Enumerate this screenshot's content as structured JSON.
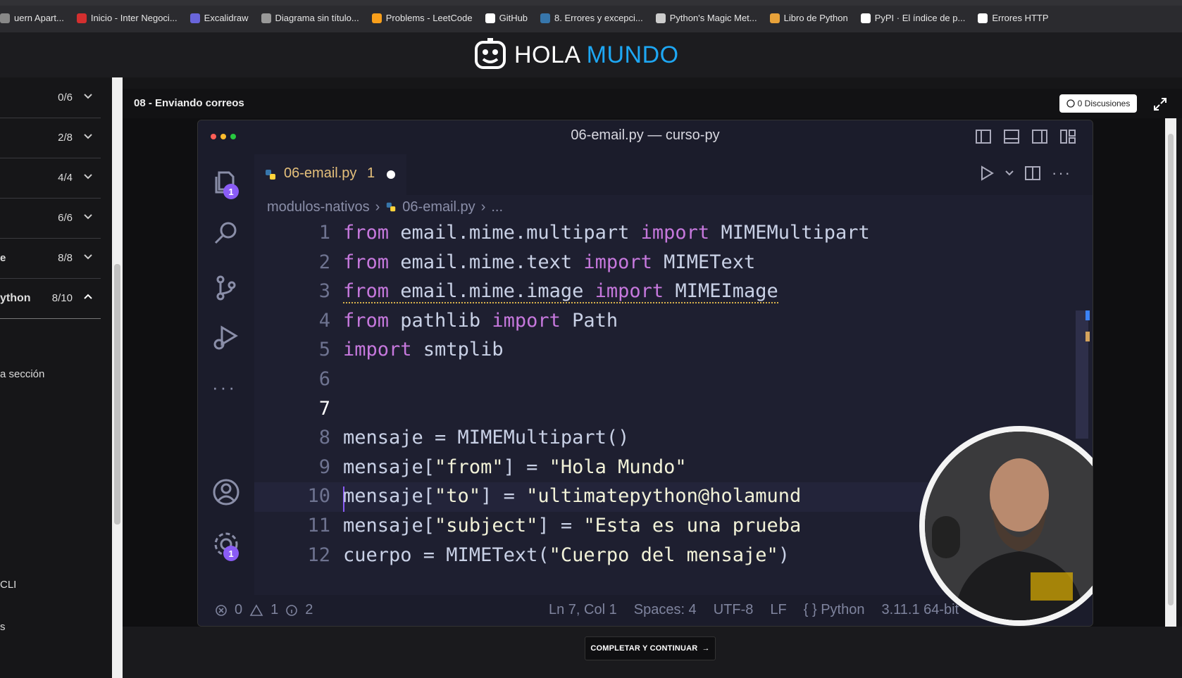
{
  "bookmarks": [
    {
      "label": "uern Apart...",
      "icon": "page-icon",
      "color": "#888888"
    },
    {
      "label": "Inicio - Inter Negoci...",
      "icon": "bank-icon",
      "color": "#d32f2f"
    },
    {
      "label": "Excalidraw",
      "icon": "excalidraw-icon",
      "color": "#6965db"
    },
    {
      "label": "Diagrama sin título...",
      "icon": "diagram-icon",
      "color": "#999999"
    },
    {
      "label": "Problems - LeetCode",
      "icon": "leetcode-icon",
      "color": "#f89f1b"
    },
    {
      "label": "GitHub",
      "icon": "github-icon",
      "color": "#ffffff"
    },
    {
      "label": "8. Errores y excepci...",
      "icon": "python-icon",
      "color": "#3776ab"
    },
    {
      "label": "Python's Magic Met...",
      "icon": "globe-icon",
      "color": "#cccccc"
    },
    {
      "label": "Libro de Python",
      "icon": "book-icon",
      "color": "#e8a23a"
    },
    {
      "label": "PyPI · El índice de p...",
      "icon": "pypi-icon",
      "color": "#ffffff"
    },
    {
      "label": "Errores HTTP",
      "icon": "mdn-icon",
      "color": "#ffffff"
    }
  ],
  "logo": {
    "part1": "HOLA",
    "part2": "MUNDO"
  },
  "sidebar": {
    "sections": [
      {
        "label": "",
        "count": "0/6"
      },
      {
        "label": "",
        "count": "2/8"
      },
      {
        "label": "",
        "count": "4/4"
      },
      {
        "label": "",
        "count": "6/6"
      },
      {
        "label": "e",
        "count": "8/8"
      },
      {
        "label": "ython",
        "count": "8/10"
      }
    ],
    "items": [
      {
        "label": "a sección"
      },
      {
        "label": "CLI"
      },
      {
        "label": "s"
      }
    ]
  },
  "lesson": {
    "title": "08 - Enviando correos",
    "discussions": "0 Discusiones",
    "complete_button": "COMPLETAR Y CONTINUAR"
  },
  "vscode": {
    "window_title": "06-email.py — curso-py",
    "tab": {
      "file": "06-email.py",
      "problems": "1"
    },
    "explorer_badge": "1",
    "settings_badge": "1",
    "breadcrumb": {
      "folder": "modulos-nativos",
      "file": "06-email.py",
      "more": "..."
    },
    "lines": [
      {
        "n": "1",
        "code": "from email.mime.multipart import MIMEMultipart"
      },
      {
        "n": "2",
        "code": "from email.mime.text import MIMEText"
      },
      {
        "n": "3",
        "code": "from email.mime.image import MIMEImage"
      },
      {
        "n": "4",
        "code": "from pathlib import Path"
      },
      {
        "n": "5",
        "code": "import smtplib"
      },
      {
        "n": "6",
        "code": ""
      },
      {
        "n": "7",
        "code": ""
      },
      {
        "n": "8",
        "code": "mensaje = MIMEMultipart()"
      },
      {
        "n": "9",
        "code": "mensaje[\"from\"] = \"Hola Mundo\""
      },
      {
        "n": "10",
        "code": "mensaje[\"to\"] = \"ultimatepython@holamund"
      },
      {
        "n": "11",
        "code": "mensaje[\"subject\"] = \"Esta es una prueba"
      },
      {
        "n": "12",
        "code": "cuerpo = MIMEText(\"Cuerpo del mensaje\")"
      }
    ],
    "status": {
      "errors": "0",
      "warnings": "1",
      "info": "2",
      "position": "Ln 7, Col 1",
      "spaces": "Spaces: 4",
      "encoding": "UTF-8",
      "eol": "LF",
      "language": "Python",
      "interpreter": "3.11.1 64-bit"
    }
  },
  "colors": {
    "accent": "#8a5cf6",
    "keyword": "#c678dd",
    "brand_blue": "#1ea7f3"
  }
}
